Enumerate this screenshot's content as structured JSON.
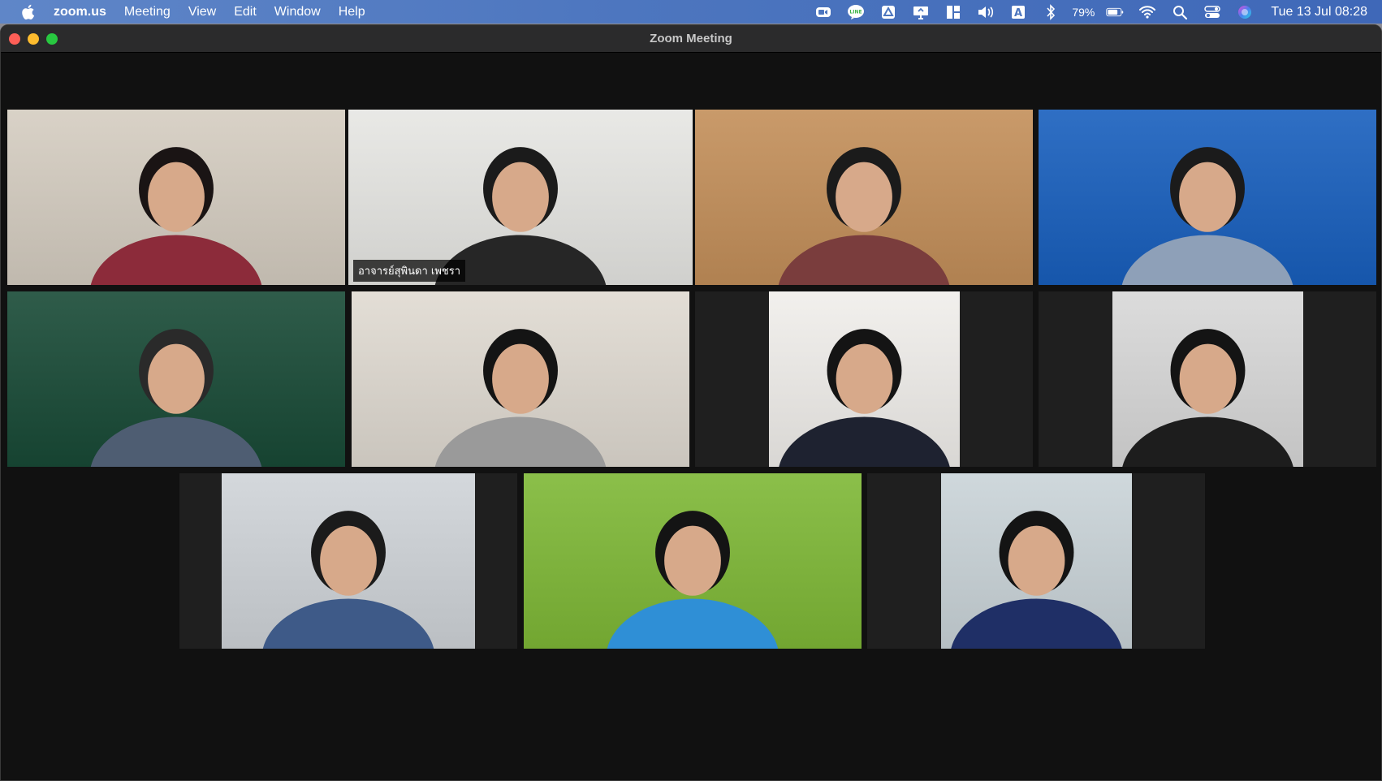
{
  "menubar": {
    "app_name": "zoom.us",
    "menus": [
      "Meeting",
      "View",
      "Edit",
      "Window",
      "Help"
    ],
    "battery_percent": "79%",
    "clock": "Tue 13 Jul  08:28",
    "status_icons": [
      "zoom-icon",
      "line-icon",
      "drive-icon",
      "screen-share-icon",
      "window-layout-icon",
      "volume-icon",
      "input-source-icon",
      "bluetooth-icon",
      "battery-icon",
      "wifi-icon",
      "spotlight-search-icon",
      "control-center-icon",
      "siri-icon"
    ]
  },
  "window": {
    "title": "Zoom Meeting"
  },
  "participants": [
    {
      "id": "p1",
      "name": "",
      "colors": {
        "bg": "#d9d2c7",
        "shirt": "#8c2b3a",
        "hair": "#1a1414"
      }
    },
    {
      "id": "p2",
      "name": "อาจารย์สุพินดา เพชรา",
      "active": true,
      "colors": {
        "bg": "#e9e9e6",
        "shirt": "#262626",
        "hair": "#1b1b1b"
      }
    },
    {
      "id": "p3",
      "name": "",
      "colors": {
        "bg": "#c99a6a",
        "shirt": "#7a3d3d",
        "hair": "#1b1b1b"
      }
    },
    {
      "id": "p4",
      "name": "",
      "colors": {
        "bg": "#2f6fc4",
        "shirt": "#8ea0b8",
        "hair": "#1b1b1b"
      }
    },
    {
      "id": "p5",
      "name": "",
      "colors": {
        "bg": "#2f5c4a",
        "shirt": "#4e5d72",
        "hair": "#2a2a2a"
      }
    },
    {
      "id": "p6",
      "name": "",
      "colors": {
        "bg": "#e3ded6",
        "shirt": "#9a9a9a",
        "hair": "#141414"
      }
    },
    {
      "id": "p7",
      "name": "",
      "colors": {
        "bg": "#f2f0ed",
        "shirt": "#1e2230",
        "hair": "#141414"
      }
    },
    {
      "id": "p8",
      "name": "",
      "colors": {
        "bg": "#dcdcdc",
        "shirt": "#1d1d1d",
        "hair": "#141414"
      }
    },
    {
      "id": "p9",
      "name": "",
      "colors": {
        "bg": "#d4d8dc",
        "shirt": "#3e5a88",
        "hair": "#1b1b1b"
      }
    },
    {
      "id": "p10",
      "name": "",
      "colors": {
        "bg": "#8bbf4a",
        "shirt": "#2f8fd6",
        "hair": "#141414"
      }
    },
    {
      "id": "p11",
      "name": "",
      "colors": {
        "bg": "#cfd8dc",
        "shirt": "#1f2f66",
        "hair": "#141414"
      }
    }
  ]
}
